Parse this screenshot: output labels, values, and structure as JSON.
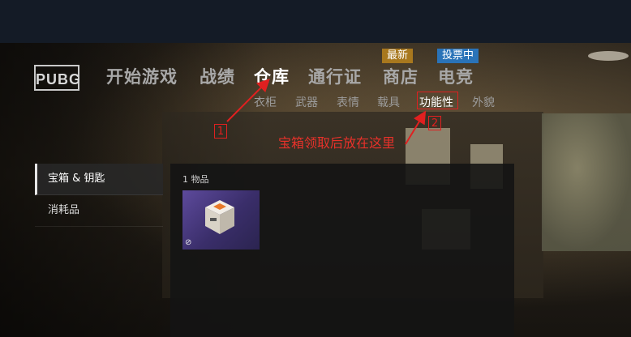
{
  "brand": {
    "logo_text": "PUBG"
  },
  "nav": {
    "items": [
      "开始游戏",
      "战绩",
      "仓库",
      "通行证",
      "商店",
      "电竞"
    ],
    "active": "仓库",
    "badges": {
      "shop": "最新",
      "esports": "投票中"
    }
  },
  "subnav": {
    "items": [
      "衣柜",
      "武器",
      "表情",
      "载具",
      "功能性",
      "外貌"
    ],
    "active": "功能性"
  },
  "annotation": {
    "marker_1": "1",
    "marker_2": "2",
    "note": "宝箱领取后放在这里",
    "color": "#e02020"
  },
  "sidebar": {
    "items": [
      "宝箱 & 钥匙",
      "消耗品"
    ],
    "active": "宝箱 & 钥匙"
  },
  "inventory": {
    "count_label": "1 物品",
    "items": [
      {
        "icon": "crate-icon",
        "status_icon": "unavailable-icon"
      }
    ]
  },
  "colors": {
    "badge_orange": "#a8781e",
    "badge_blue": "#2a73b8"
  }
}
